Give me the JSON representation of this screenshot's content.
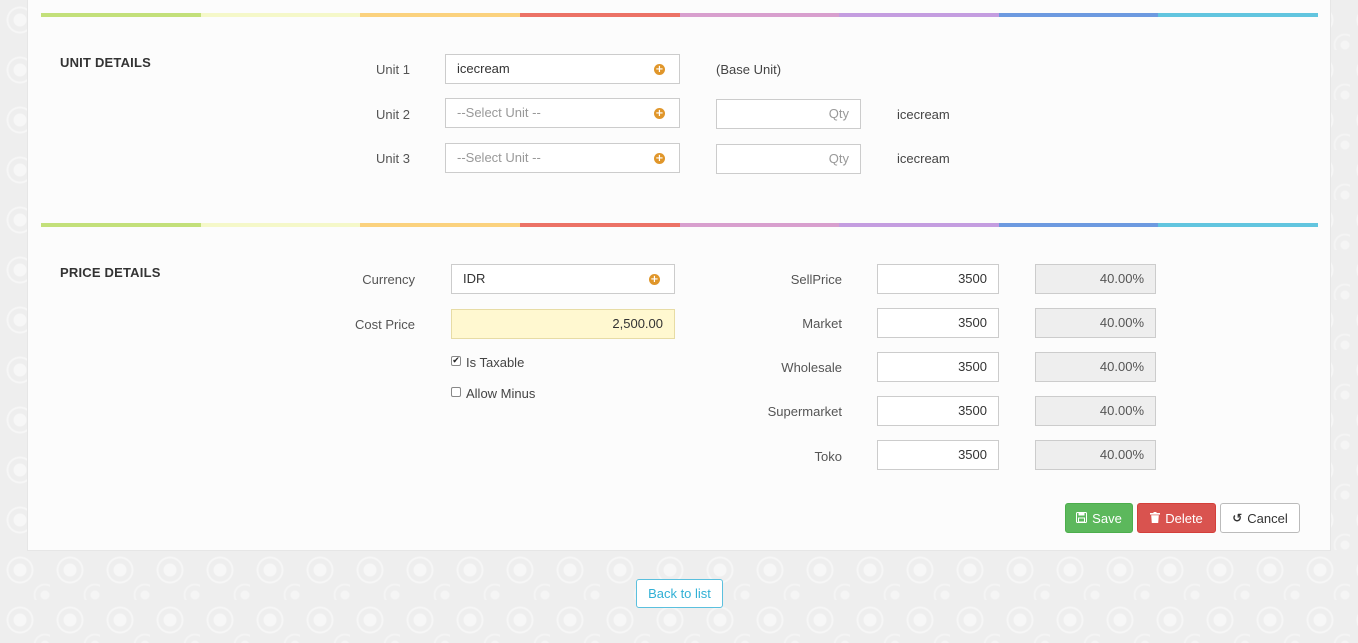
{
  "rainbow_colors": [
    "#c3e07a",
    "#f5f8c9",
    "#fbd27e",
    "#ec7266",
    "#d89fce",
    "#c49de0",
    "#6d9ae0",
    "#62c5df"
  ],
  "unit_details": {
    "title": "UNIT DETAILS",
    "base_unit_note": "(Base Unit)",
    "qty_placeholder": "Qty",
    "rows": [
      {
        "label": "Unit 1",
        "value": "icecream"
      },
      {
        "label": "Unit 2",
        "placeholder": "--Select Unit --",
        "suffix": "icecream"
      },
      {
        "label": "Unit 3",
        "placeholder": "--Select Unit --",
        "suffix": "icecream"
      }
    ]
  },
  "price_details": {
    "title": "PRICE DETAILS",
    "currency_label": "Currency",
    "currency_value": "IDR",
    "cost_price_label": "Cost Price",
    "cost_price_value": "2,500.00",
    "is_taxable_label": "Is Taxable",
    "is_taxable_checked": true,
    "allow_minus_label": "Allow Minus",
    "allow_minus_checked": false,
    "prices": [
      {
        "label": "SellPrice",
        "value": "3500",
        "margin": "40.00%"
      },
      {
        "label": "Market",
        "value": "3500",
        "margin": "40.00%"
      },
      {
        "label": "Wholesale",
        "value": "3500",
        "margin": "40.00%"
      },
      {
        "label": "Supermarket",
        "value": "3500",
        "margin": "40.00%"
      },
      {
        "label": "Toko",
        "value": "3500",
        "margin": "40.00%"
      }
    ]
  },
  "actions": {
    "save_label": "Save",
    "delete_label": "Delete",
    "cancel_label": "Cancel",
    "back_label": "Back to list"
  },
  "icons": {
    "add": "plus-circle-icon",
    "save": "floppy-disk-icon",
    "delete": "trash-icon",
    "cancel": "undo-icon"
  }
}
